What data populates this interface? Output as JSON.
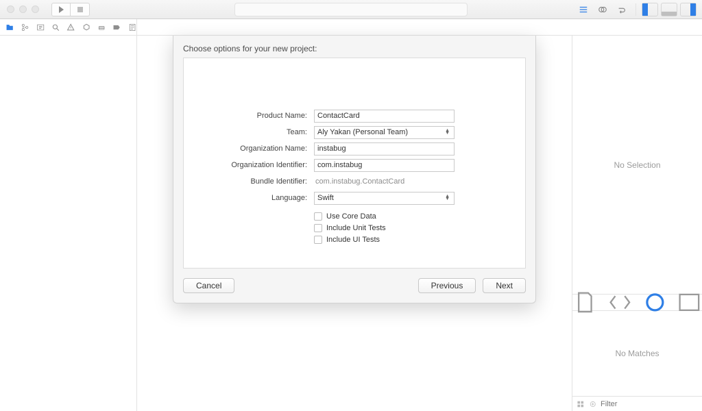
{
  "dialog": {
    "heading": "Choose options for your new project:",
    "labels": {
      "product_name": "Product Name:",
      "team": "Team:",
      "org_name": "Organization Name:",
      "org_id": "Organization Identifier:",
      "bundle_id": "Bundle Identifier:",
      "language": "Language:"
    },
    "values": {
      "product_name": "ContactCard",
      "team": "Aly Yakan (Personal Team)",
      "org_name": "instabug",
      "org_id": "com.instabug",
      "bundle_id": "com.instabug.ContactCard",
      "language": "Swift"
    },
    "checkboxes": {
      "core_data": "Use Core Data",
      "unit_tests": "Include Unit Tests",
      "ui_tests": "Include UI Tests"
    },
    "buttons": {
      "cancel": "Cancel",
      "previous": "Previous",
      "next": "Next"
    }
  },
  "inspector": {
    "empty_text": "No Selection"
  },
  "library": {
    "empty_text": "No Matches",
    "filter_placeholder": "Filter"
  }
}
